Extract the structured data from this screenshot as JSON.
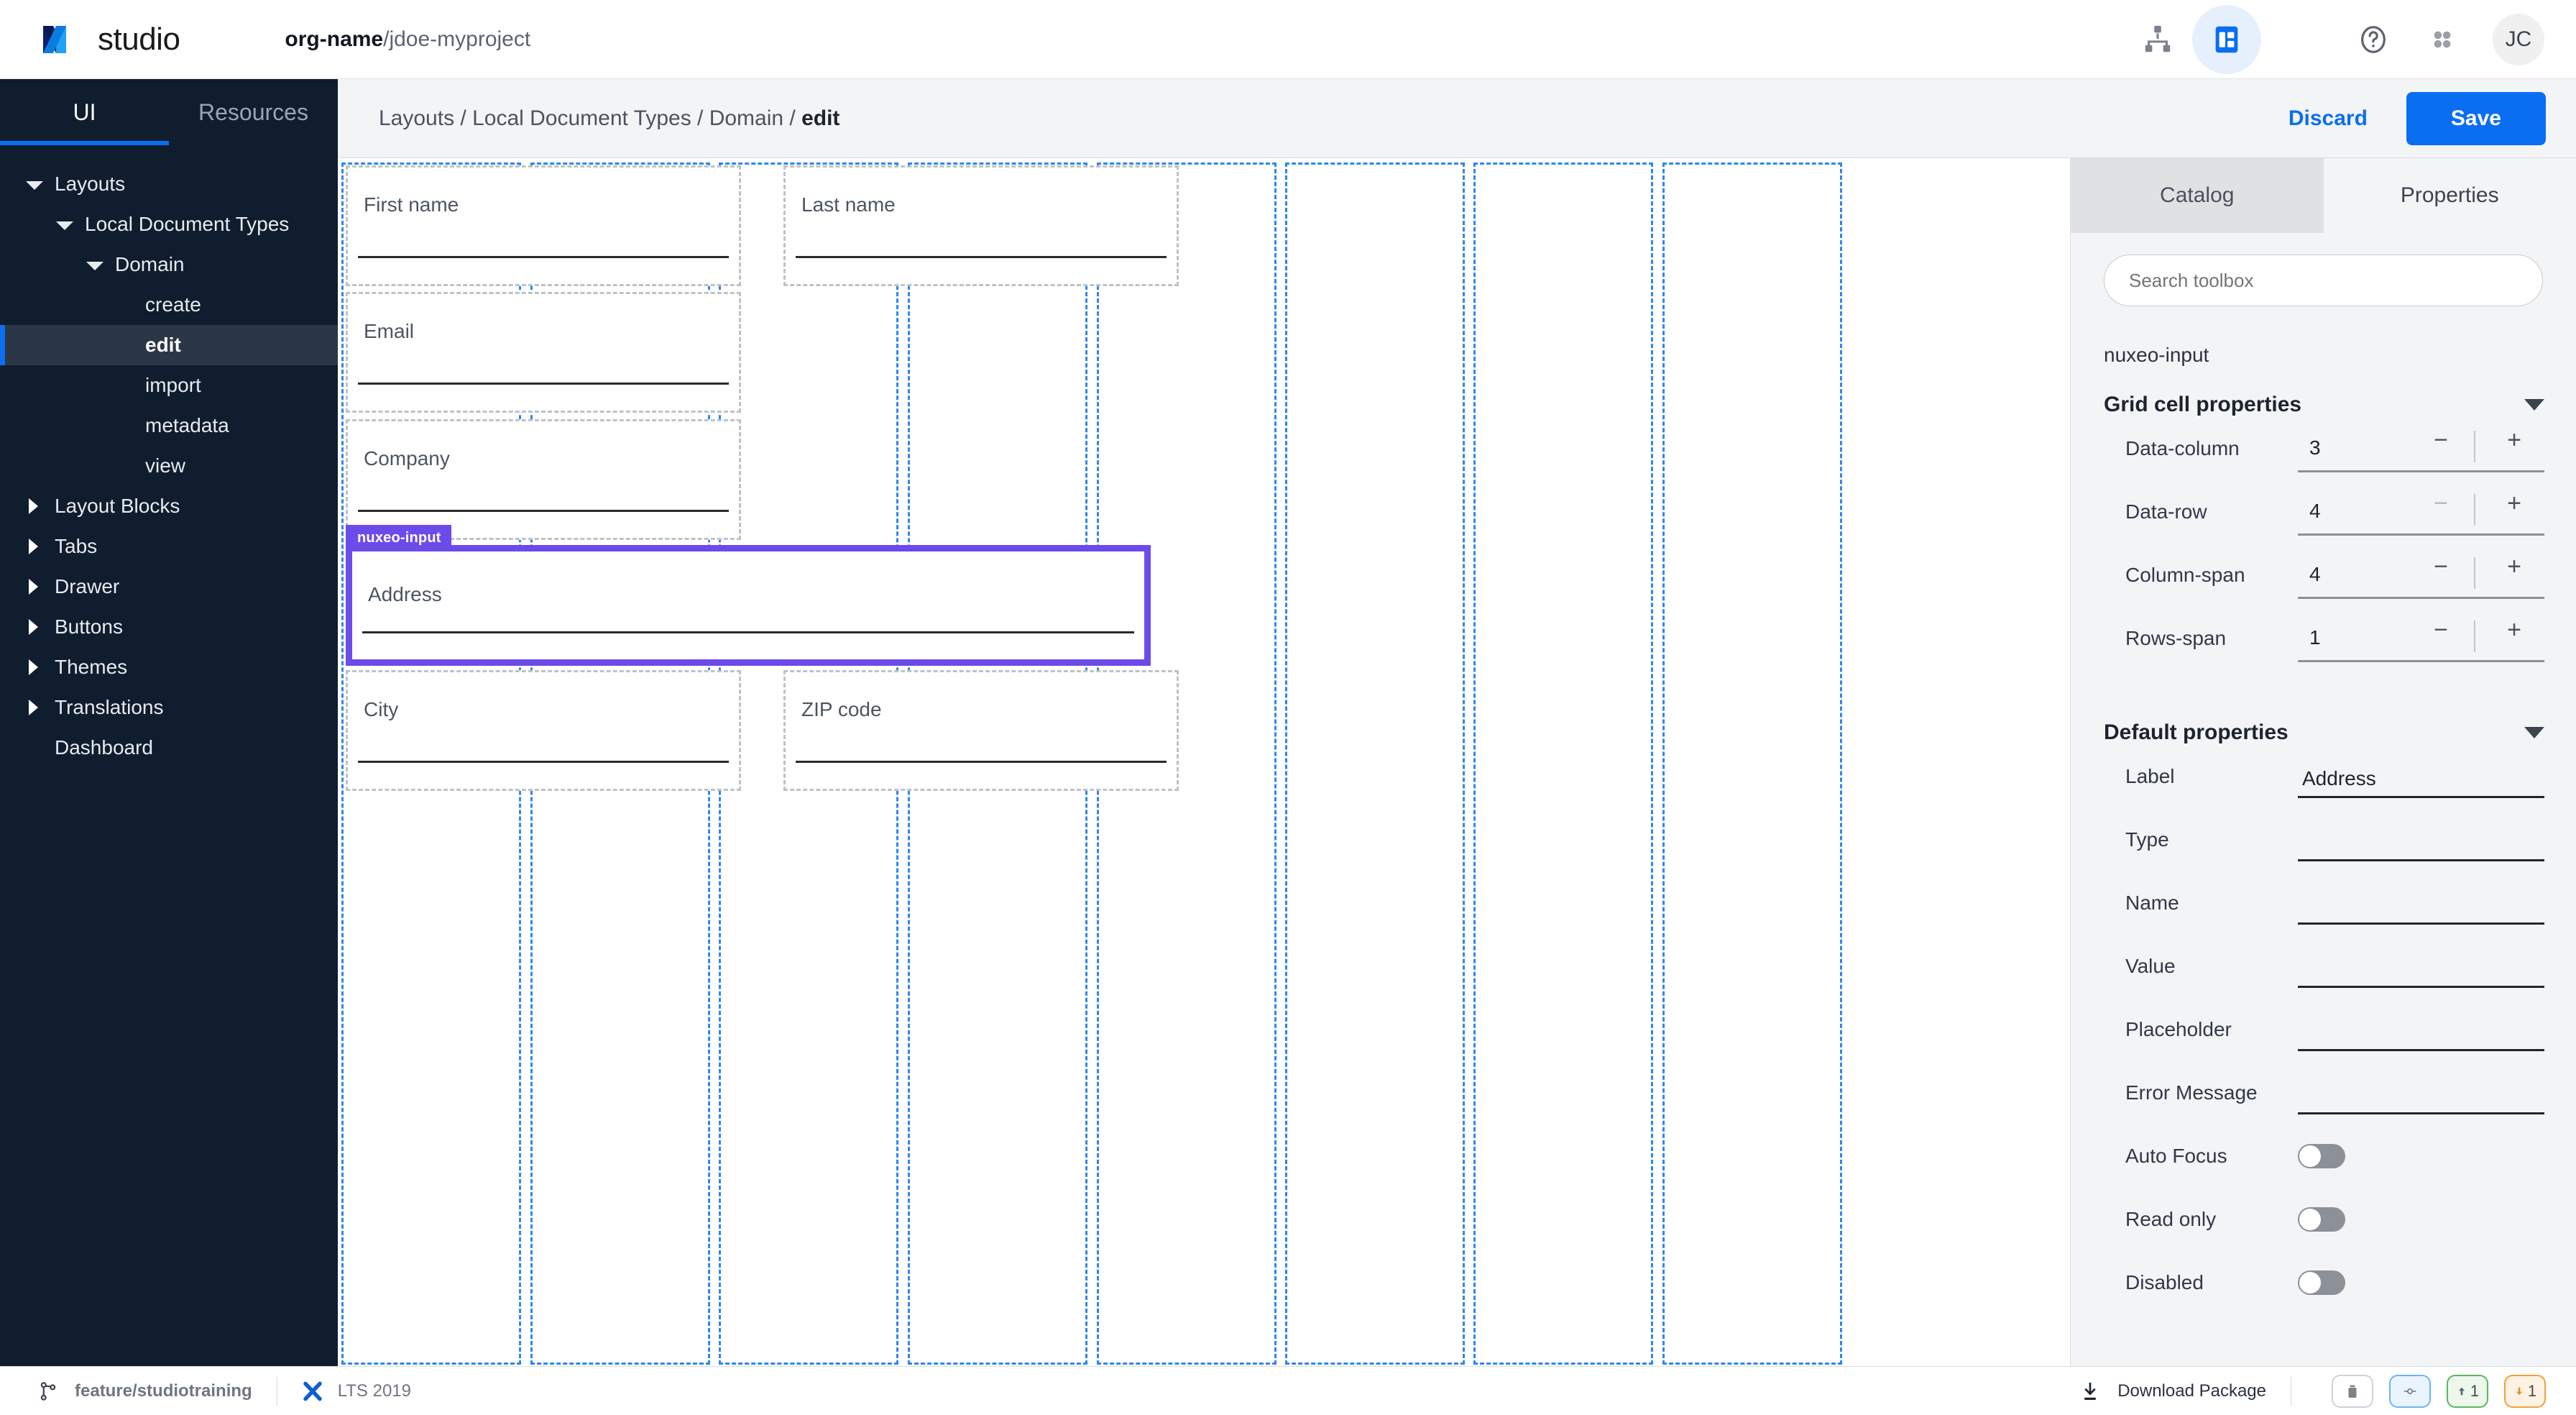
{
  "app": {
    "logo_text": "studio",
    "org_name": "org-name",
    "project_path": "/jdoe-myproject"
  },
  "header_icons": [
    {
      "name": "sitemap-icon",
      "glyph": "sitemap"
    },
    {
      "name": "layout-designer-icon",
      "glyph": "layout"
    },
    {
      "name": "help-icon",
      "glyph": "?"
    },
    {
      "name": "apps-grid-icon",
      "glyph": "apps"
    }
  ],
  "avatar": {
    "initials": "JC"
  },
  "sidebar": {
    "tabs": [
      {
        "label": "UI",
        "selected": true
      },
      {
        "label": "Resources",
        "selected": false
      }
    ],
    "tree": [
      {
        "label": "Layouts",
        "indent": 0,
        "caret": "down",
        "selected": false
      },
      {
        "label": "Local Document Types",
        "indent": 1,
        "caret": "down",
        "selected": false
      },
      {
        "label": "Domain",
        "indent": 2,
        "caret": "down",
        "selected": false
      },
      {
        "label": "create",
        "indent": 3,
        "caret": "none",
        "selected": false
      },
      {
        "label": "edit",
        "indent": 3,
        "caret": "none",
        "selected": true
      },
      {
        "label": "import",
        "indent": 3,
        "caret": "none",
        "selected": false
      },
      {
        "label": "metadata",
        "indent": 3,
        "caret": "none",
        "selected": false
      },
      {
        "label": "view",
        "indent": 3,
        "caret": "none",
        "selected": false
      },
      {
        "label": "Layout Blocks",
        "indent": 0,
        "caret": "right",
        "selected": false
      },
      {
        "label": "Tabs",
        "indent": 0,
        "caret": "right",
        "selected": false
      },
      {
        "label": "Drawer",
        "indent": 0,
        "caret": "right",
        "selected": false
      },
      {
        "label": "Buttons",
        "indent": 0,
        "caret": "right",
        "selected": false
      },
      {
        "label": "Themes",
        "indent": 0,
        "caret": "right",
        "selected": false
      },
      {
        "label": "Translations",
        "indent": 0,
        "caret": "right",
        "selected": false
      },
      {
        "label": "Dashboard",
        "indent": 0,
        "caret": "none",
        "selected": false
      }
    ]
  },
  "breadcrumb": {
    "prefix": "Layouts / Local Document Types / Domain / ",
    "current": "edit"
  },
  "actions": {
    "discard_label": "Discard",
    "save_label": "Save"
  },
  "canvas": {
    "grid_columns": 8,
    "selection_badge": "nuxeo-input",
    "fields": [
      {
        "label": "First name",
        "col": 3,
        "row": 1,
        "colspan": 2,
        "rowspan": 1,
        "selected": false
      },
      {
        "label": "Last name",
        "col": 5,
        "row": 1,
        "colspan": 2,
        "rowspan": 1,
        "selected": false
      },
      {
        "label": "Email",
        "col": 3,
        "row": 2,
        "colspan": 2,
        "rowspan": 1,
        "selected": false
      },
      {
        "label": "Company",
        "col": 3,
        "row": 3,
        "colspan": 2,
        "rowspan": 1,
        "selected": false
      },
      {
        "label": "Address",
        "col": 3,
        "row": 4,
        "colspan": 4,
        "rowspan": 1,
        "selected": true
      },
      {
        "label": "City",
        "col": 3,
        "row": 5,
        "colspan": 2,
        "rowspan": 1,
        "selected": false
      },
      {
        "label": "ZIP code",
        "col": 5,
        "row": 5,
        "colspan": 2,
        "rowspan": 1,
        "selected": false
      }
    ]
  },
  "properties_panel": {
    "tabs": [
      {
        "label": "Catalog",
        "selected": false
      },
      {
        "label": "Properties",
        "selected": true
      }
    ],
    "search_placeholder": "Search toolbox",
    "component_name": "nuxeo-input",
    "grid_section": {
      "title": "Grid cell properties",
      "rows": [
        {
          "label": "Data-column",
          "value": "3",
          "minus_dim": false
        },
        {
          "label": "Data-row",
          "value": "4",
          "minus_dim": true
        },
        {
          "label": "Column-span",
          "value": "4",
          "minus_dim": false
        },
        {
          "label": "Rows-span",
          "value": "1",
          "minus_dim": false
        }
      ],
      "minus_label": "−",
      "plus_label": "+"
    },
    "default_section": {
      "title": "Default properties",
      "text_rows": [
        {
          "label": "Label",
          "value": "Address"
        },
        {
          "label": "Type",
          "value": ""
        },
        {
          "label": "Name",
          "value": ""
        },
        {
          "label": "Value",
          "value": ""
        },
        {
          "label": "Placeholder",
          "value": ""
        },
        {
          "label": "Error Message",
          "value": ""
        }
      ],
      "toggle_rows": [
        {
          "label": "Auto Focus",
          "on": false
        },
        {
          "label": "Read only",
          "on": false
        },
        {
          "label": "Disabled",
          "on": false
        }
      ]
    }
  },
  "status_bar": {
    "branch": "feature/studiotraining",
    "version": "LTS 2019",
    "download_label": "Download Package",
    "chips": [
      {
        "name": "trash-chip",
        "text": ""
      },
      {
        "name": "preview-chip",
        "text": ""
      },
      {
        "name": "ahead-chip",
        "text": "1"
      },
      {
        "name": "behind-chip",
        "text": "1"
      }
    ]
  },
  "colors": {
    "accent_blue": "#0a6ef0",
    "sidebar_navy": "#101d2e",
    "selection_purple": "#6d4aea",
    "grid_guide_blue": "#2f86f0"
  }
}
